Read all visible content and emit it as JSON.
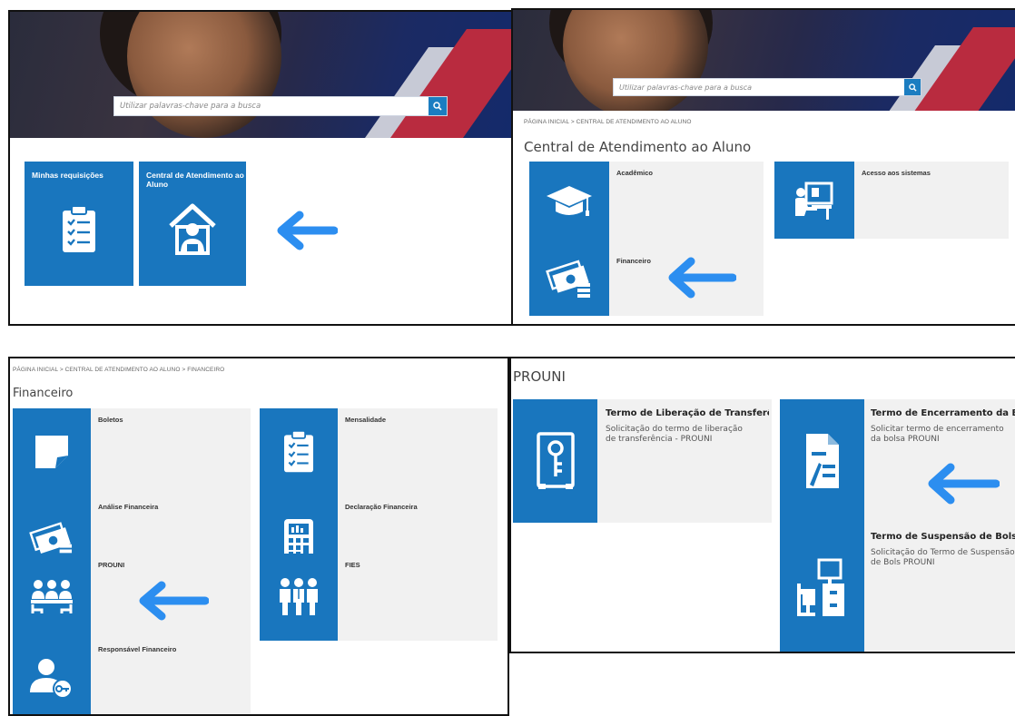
{
  "panel1": {
    "search_placeholder": "Utilizar palavras-chave para a busca",
    "tiles": [
      {
        "label": "Minhas requisições"
      },
      {
        "label": "Central de Atendimento ao Aluno"
      }
    ]
  },
  "panel2": {
    "search_placeholder": "Utilizar palavras-chave para a busca",
    "breadcrumb": "PÁGINA INICIAL  >  CENTRAL DE ATENDIMENTO AO ALUNO",
    "page_title": "Central de Atendimento ao Aluno",
    "tiles": [
      {
        "label": "Acadêmico"
      },
      {
        "label": "Acesso aos sistemas"
      },
      {
        "label": "Financeiro"
      }
    ]
  },
  "panel3": {
    "breadcrumb": "PÁGINA INICIAL  >  CENTRAL DE ATENDIMENTO AO ALUNO  >  FINANCEIRO",
    "page_title": "Financeiro",
    "tiles": [
      {
        "label": "Boletos"
      },
      {
        "label": "Mensalidade"
      },
      {
        "label": "Análise Financeira"
      },
      {
        "label": "Declaração Financeira"
      },
      {
        "label": "PROUNI"
      },
      {
        "label": "FIES"
      },
      {
        "label": "Responsável Financeiro"
      }
    ]
  },
  "panel4": {
    "page_title": "PROUNI",
    "tiles": [
      {
        "title": "Termo de Liberação de Transferência - P...",
        "desc": "Solicitação do termo de liberação de transferência - PROUNI"
      },
      {
        "title": "Termo de Encerramento da Bolsa PRO",
        "desc": "Solicitar termo de encerramento da bolsa PROUNI"
      },
      {
        "title": "Termo de Suspensão de Bolsa PROUNI",
        "desc": "Solicitação do Termo de Suspensão de Bols PROUNI"
      }
    ]
  },
  "colors": {
    "tile_blue": "#1976be",
    "arrow_blue": "#2c8ef0",
    "tile_bg": "#f1f1f1"
  }
}
